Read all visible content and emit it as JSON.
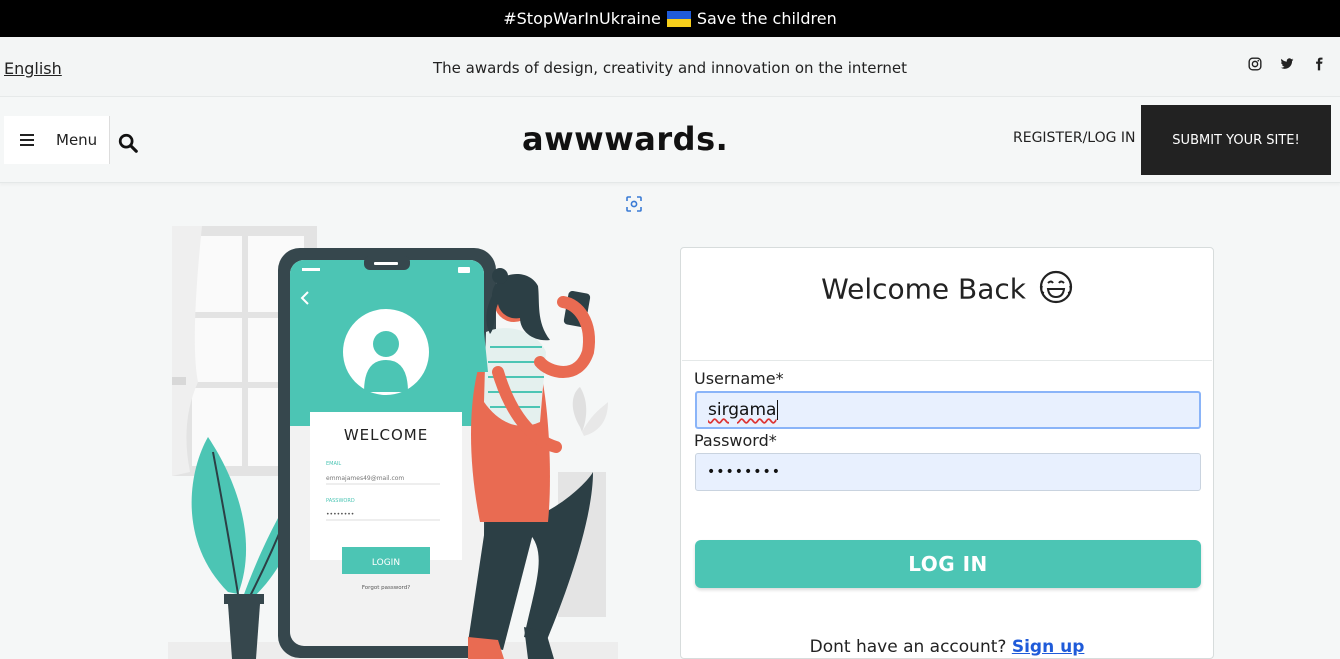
{
  "banner": {
    "text": "#StopWarInUkraine",
    "text_after_flag": "Save the children"
  },
  "subbar": {
    "language": "English",
    "tagline": "The awards of design, creativity and innovation on the internet"
  },
  "nav": {
    "menu_label": "Menu",
    "logo": "awwwards.",
    "register_label": "REGISTER/LOG IN",
    "submit_label": "SUBMIT YOUR SITE!"
  },
  "illustration": {
    "screen_title": "WELCOME",
    "email_label": "EMAIL",
    "email_value": "emmajames49@mail.com",
    "password_label": "PASSWORD",
    "password_value": "••••••••",
    "button": "LOGIN",
    "forgot": "Forgot password?"
  },
  "login": {
    "title": "Welcome Back",
    "username_label": "Username*",
    "username_value": "sirgama",
    "password_label": "Password*",
    "password_value": "••••••••",
    "button_label": "LOG IN",
    "signup_prompt": "Dont have an account?",
    "signup_link": "Sign up"
  },
  "colors": {
    "accent": "#4cc5b4",
    "link": "#1f5bd9",
    "dark": "#222222",
    "input_bg": "#e8f0fe"
  },
  "icons": [
    "instagram-icon",
    "twitter-icon",
    "facebook-icon",
    "hamburger-icon",
    "search-icon",
    "capture-icon",
    "laughing-emoji-icon",
    "ukraine-flag-icon"
  ]
}
